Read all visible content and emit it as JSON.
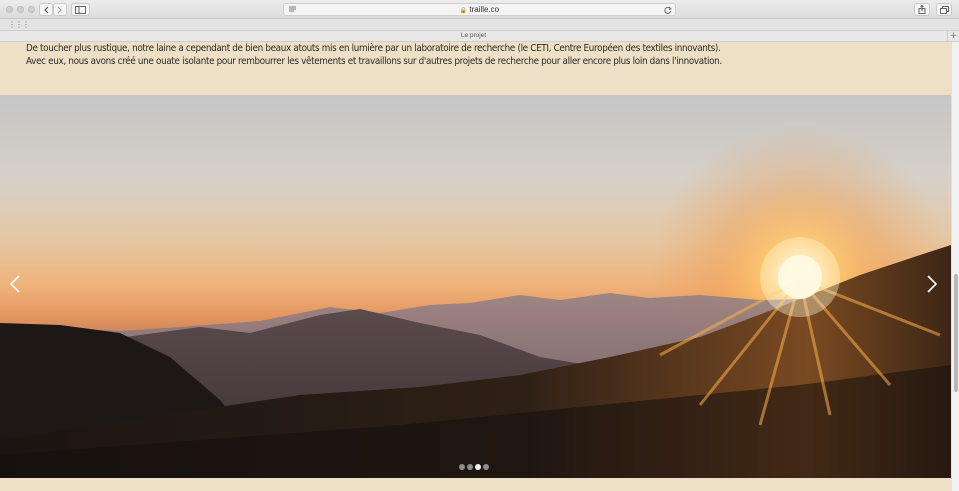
{
  "browser": {
    "url": "traille.co",
    "tab_title": "Le projet"
  },
  "content": {
    "paragraph_1": "De toucher plus rustique, notre laine a cependant de bien beaux atouts mis en lumière par un laboratoire de recherche (le CETI, Centre Européen des textiles innovants).",
    "paragraph_2": "Avec eux, nous avons créé une ouate isolante pour rembourrer les vêtements et travaillons sur d'autres projets de recherche pour aller encore plus loin dans l'innovation."
  },
  "carousel": {
    "slide_count": 4,
    "active_index": 2,
    "image": "sunset-mountains-photo"
  },
  "colors": {
    "page_background": "#ede0c7",
    "text": "#2c2a26",
    "dot_active": "#f2f2f2",
    "dot_inactive": "#8d8d8d"
  }
}
